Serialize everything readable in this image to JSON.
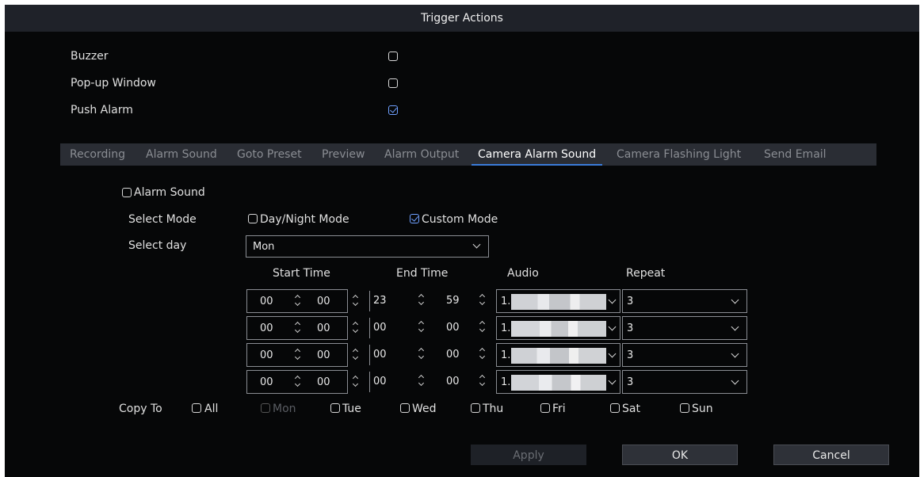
{
  "title": "Trigger Actions",
  "triggers": [
    {
      "label": "Buzzer",
      "checked": false
    },
    {
      "label": "Pop-up Window",
      "checked": false
    },
    {
      "label": "Push Alarm",
      "checked": true
    }
  ],
  "tabs": [
    {
      "label": "Recording",
      "active": false
    },
    {
      "label": "Alarm Sound",
      "active": false
    },
    {
      "label": "Goto Preset",
      "active": false
    },
    {
      "label": "Preview",
      "active": false
    },
    {
      "label": "Alarm Output",
      "active": false
    },
    {
      "label": "Camera Alarm Sound",
      "active": true
    },
    {
      "label": "Camera Flashing Light",
      "active": false
    },
    {
      "label": "Send Email",
      "active": false
    }
  ],
  "alarm_sound": {
    "label": "Alarm Sound",
    "checked": false
  },
  "select_mode": {
    "label": "Select Mode",
    "options": [
      {
        "label": "Day/Night Mode",
        "checked": false
      },
      {
        "label": "Custom Mode",
        "checked": true
      }
    ]
  },
  "select_day": {
    "label": "Select day",
    "value": "Mon"
  },
  "schedule": {
    "headers": {
      "start": "Start Time",
      "end": "End Time",
      "audio": "Audio",
      "repeat": "Repeat"
    },
    "rows": [
      {
        "start_h": "00",
        "start_m": "00",
        "end_h": "23",
        "end_m": "59",
        "audio": "1.",
        "repeat": "3"
      },
      {
        "start_h": "00",
        "start_m": "00",
        "end_h": "00",
        "end_m": "00",
        "audio": "1.",
        "repeat": "3"
      },
      {
        "start_h": "00",
        "start_m": "00",
        "end_h": "00",
        "end_m": "00",
        "audio": "1.",
        "repeat": "3"
      },
      {
        "start_h": "00",
        "start_m": "00",
        "end_h": "00",
        "end_m": "00",
        "audio": "1.",
        "repeat": "3"
      }
    ]
  },
  "copy_to": {
    "label": "Copy To",
    "options": [
      {
        "label": "All",
        "disabled": false
      },
      {
        "label": "Mon",
        "disabled": true
      },
      {
        "label": "Tue",
        "disabled": false
      },
      {
        "label": "Wed",
        "disabled": false
      },
      {
        "label": "Thu",
        "disabled": false
      },
      {
        "label": "Fri",
        "disabled": false
      },
      {
        "label": "Sat",
        "disabled": false
      },
      {
        "label": "Sun",
        "disabled": false
      }
    ]
  },
  "buttons": {
    "apply": "Apply",
    "ok": "OK",
    "cancel": "Cancel"
  },
  "colors": {
    "background": "#060708",
    "titlebar": "#1f2229",
    "accent": "#3b7bd9",
    "check": "#6fa0ff"
  }
}
